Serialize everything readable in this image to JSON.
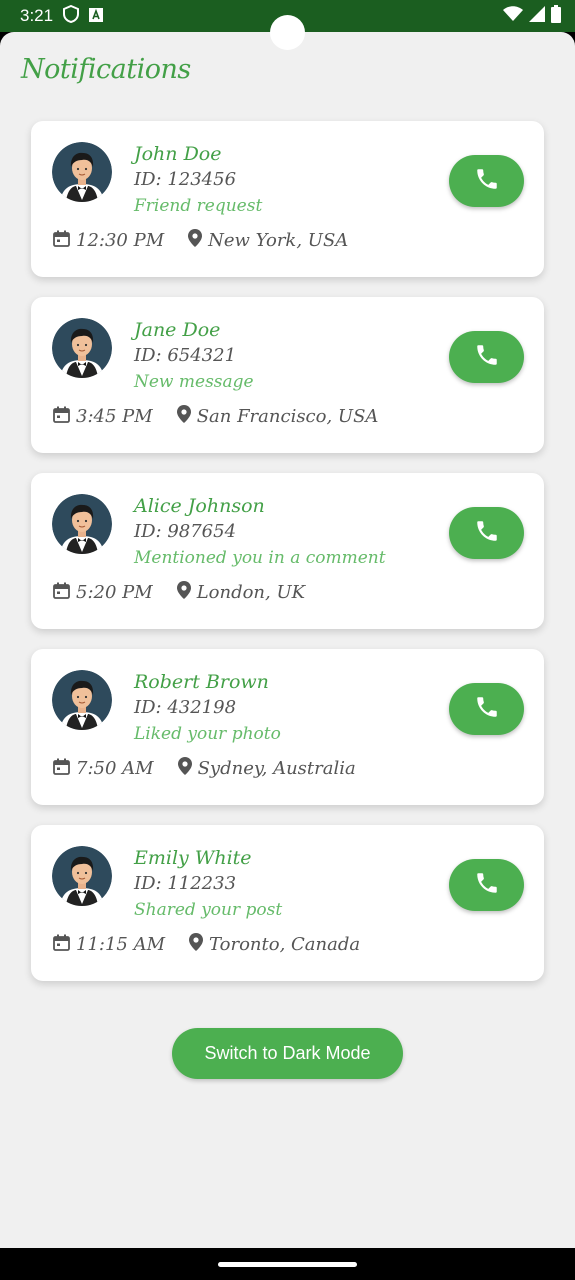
{
  "status_bar": {
    "time": "3:21",
    "icons": [
      "shield-icon",
      "a-badge-icon",
      "wifi-icon",
      "signal-icon",
      "battery-icon"
    ]
  },
  "page": {
    "title": "Notifications",
    "accent_color": "#43a047",
    "button_color": "#4caf50"
  },
  "notifications": [
    {
      "name": "John Doe",
      "id": "ID: 123456",
      "message": "Friend request",
      "time": "12:30 PM",
      "location": "New York, USA"
    },
    {
      "name": "Jane Doe",
      "id": "ID: 654321",
      "message": "New message",
      "time": "3:45 PM",
      "location": "San Francisco, USA"
    },
    {
      "name": "Alice Johnson",
      "id": "ID: 987654",
      "message": "Mentioned you in a comment",
      "time": "5:20 PM",
      "location": "London, UK"
    },
    {
      "name": "Robert Brown",
      "id": "ID: 432198",
      "message": "Liked your photo",
      "time": "7:50 AM",
      "location": "Sydney, Australia"
    },
    {
      "name": "Emily White",
      "id": "ID: 112233",
      "message": "Shared your post",
      "time": "11:15 AM",
      "location": "Toronto, Canada"
    }
  ],
  "dark_mode_button": {
    "label": "Switch to Dark Mode"
  }
}
